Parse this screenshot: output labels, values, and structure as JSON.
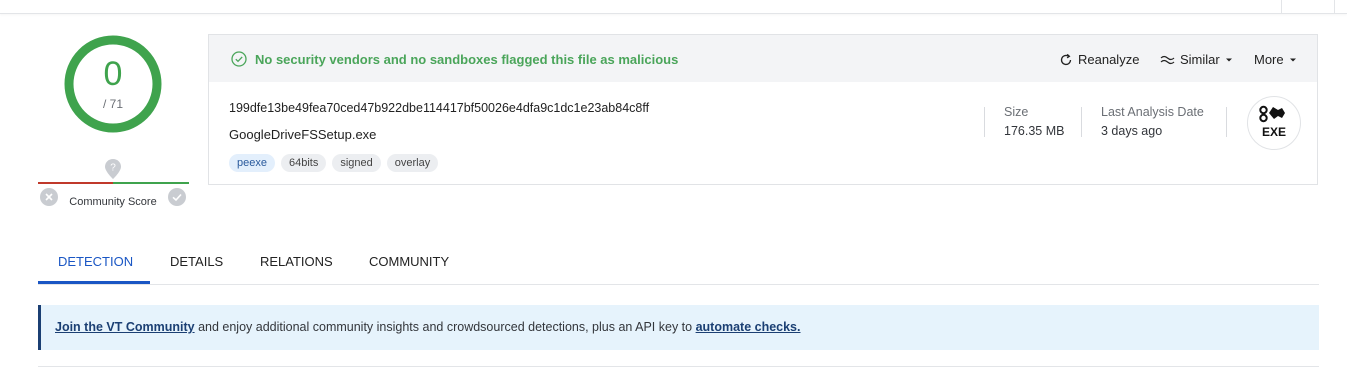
{
  "score": {
    "detections": "0",
    "total": "/ 71",
    "community_label": "Community Score"
  },
  "status": {
    "message": "No security vendors and no sandboxes flagged this file as malicious",
    "color": "#4aa55a"
  },
  "actions": {
    "reanalyze": "Reanalyze",
    "similar": "Similar",
    "more": "More"
  },
  "file": {
    "sha256": "199dfe13be49fea70ced47b922dbe114417bf50026e4dfa9c1dc1e23ab84c8ff",
    "name": "GoogleDriveFSSetup.exe",
    "tags": [
      "peexe",
      "64bits",
      "signed",
      "overlay"
    ],
    "size_label": "Size",
    "size_value": "176.35 MB",
    "date_label": "Last Analysis Date",
    "date_value": "3 days ago",
    "type_badge": "EXE"
  },
  "tabs": [
    "DETECTION",
    "DETAILS",
    "RELATIONS",
    "COMMUNITY"
  ],
  "banner": {
    "link1": "Join the VT Community",
    "middle": " and enjoy additional community insights and crowdsourced detections, plus an API key to ",
    "link2": "automate checks."
  },
  "colors": {
    "accent": "#1a56c4",
    "clean": "#3fa34d",
    "banner_bg": "#e6f3fc"
  }
}
